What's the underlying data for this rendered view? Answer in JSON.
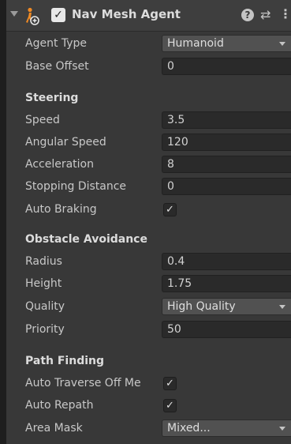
{
  "component": {
    "title": "Nav Mesh Agent",
    "enabled_mark": "✓",
    "help_glyph": "?",
    "preset_glyph": "⇄",
    "menu_glyph": "⋮"
  },
  "fields": {
    "agent_type": {
      "label": "Agent Type",
      "value": "Humanoid"
    },
    "base_offset": {
      "label": "Base Offset",
      "value": "0"
    }
  },
  "steering": {
    "header": "Steering",
    "speed": {
      "label": "Speed",
      "value": "3.5"
    },
    "angular_speed": {
      "label": "Angular Speed",
      "value": "120"
    },
    "acceleration": {
      "label": "Acceleration",
      "value": "8"
    },
    "stopping_distance": {
      "label": "Stopping Distance",
      "value": "0"
    },
    "auto_braking": {
      "label": "Auto Braking",
      "checked": true,
      "mark": "✓"
    }
  },
  "obstacle_avoidance": {
    "header": "Obstacle Avoidance",
    "radius": {
      "label": "Radius",
      "value": "0.4"
    },
    "height": {
      "label": "Height",
      "value": "1.75"
    },
    "quality": {
      "label": "Quality",
      "value": "High Quality"
    },
    "priority": {
      "label": "Priority",
      "value": "50"
    }
  },
  "path_finding": {
    "header": "Path Finding",
    "auto_traverse": {
      "label": "Auto Traverse Off Me",
      "checked": true,
      "mark": "✓"
    },
    "auto_repath": {
      "label": "Auto Repath",
      "checked": true,
      "mark": "✓"
    },
    "area_mask": {
      "label": "Area Mask",
      "value": "Mixed..."
    }
  },
  "colors": {
    "panel_bg": "#383838",
    "field_bg": "#2a2a2a",
    "dropdown_bg": "#515151",
    "icon_orange": "#f08a24"
  },
  "icons": [
    "foldout-arrow-icon",
    "nav-mesh-agent-icon",
    "help-icon",
    "preset-icon",
    "context-menu-icon",
    "dropdown-caret-icon",
    "checkmark-icon"
  ]
}
